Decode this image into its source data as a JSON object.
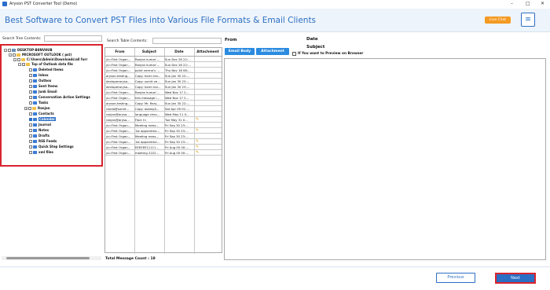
{
  "window": {
    "title": "Aryson PST Converter Tool (Demo)",
    "minimize": "–",
    "maximize": "□",
    "close": "✕"
  },
  "header": {
    "headline": "Best Software to Convert PST Files into Various File Formats & Email Clients",
    "live_chat": "Live Chat",
    "menu_icon": "≡"
  },
  "tree": {
    "search_label": "Search Tree Contents:",
    "search_value": "",
    "items": [
      {
        "label": "DESKTOP-B8NVHUB",
        "icon": "computer-icon"
      },
      {
        "label": "MICROSOFT OUTLOOK ( pst)",
        "icon": "folder-icon"
      },
      {
        "label": "C:\\Users\\Admin\\Downloads\\all forr",
        "icon": "folder-icon"
      },
      {
        "label": "Top of Outlook data file",
        "icon": "folder-icon"
      },
      {
        "label": "Deleted Items",
        "icon": "folder-icon"
      },
      {
        "label": "Inbox",
        "icon": "folder-icon"
      },
      {
        "label": "Outbox",
        "icon": "folder-icon"
      },
      {
        "label": "Sent Items",
        "icon": "folder-icon"
      },
      {
        "label": "Junk Email",
        "icon": "folder-icon"
      },
      {
        "label": "Conversation Action Settings",
        "icon": "folder-icon"
      },
      {
        "label": "Tasks",
        "icon": "folder-icon"
      },
      {
        "label": "Ranjan",
        "icon": "folder-icon"
      },
      {
        "label": "Contacts",
        "icon": "folder-icon"
      },
      {
        "label": "Calendar",
        "icon": "folder-icon"
      },
      {
        "label": "Journal",
        "icon": "folder-icon"
      },
      {
        "label": "Notes",
        "icon": "folder-icon"
      },
      {
        "label": "Drafts",
        "icon": "folder-icon"
      },
      {
        "label": "RSS Feeds",
        "icon": "folder-icon"
      },
      {
        "label": "Quick Step Settings",
        "icon": "folder-icon"
      },
      {
        "label": "xml files",
        "icon": "folder-icon"
      }
    ]
  },
  "table": {
    "search_label": "Search Table Contents:",
    "search_value": "",
    "headers": [
      "From",
      "Subject",
      "Date",
      "Attachment"
    ],
    "rows": [
      {
        "from": "/o=First Organ...",
        "subject": "Ranjan kumar’...",
        "date": "Sun Dec 26 22:...",
        "attachment": false
      },
      {
        "from": "/o=First Organ...",
        "subject": "Ranjan kumar’...",
        "date": "Sun Dec 26 22:...",
        "attachment": false
      },
      {
        "from": "/o=First Organ...",
        "subject": "point verma’s ...",
        "date": "Thu Nov 18 08:...",
        "attachment": false
      },
      {
        "from": "aryson.testing...",
        "subject": "Copy: harm hai...",
        "date": "Sun Jan 30 22:...",
        "attachment": false
      },
      {
        "from": "devloperaryso...",
        "subject": "Copy: sumit ve...",
        "date": "Sun Jan 30 22:...",
        "attachment": false
      },
      {
        "from": "devloperaryso...",
        "subject": "Copy: harm hai...",
        "date": "Sun Jan 30 23:...",
        "attachment": false
      },
      {
        "from": "/o=First Organ...",
        "subject": "Ranjan kumar’...",
        "date": "Wed Nov 17 2...",
        "attachment": false
      },
      {
        "from": "/o=First Organ...",
        "subject": "this message i...",
        "date": "Wed Nov 17 2...",
        "attachment": false
      },
      {
        "from": "aryson.testing...",
        "subject": "Copy: Mr. Ranj...",
        "date": "Sun Jan 30 22:...",
        "attachment": false
      },
      {
        "from": "randa@sumit...",
        "subject": "Copy: asdas(A...",
        "date": "Sat Apr 09 01:...",
        "attachment": false
      },
      {
        "from": "ranjan@aryso...",
        "subject": "language chec...",
        "date": "Wed May 11 0...",
        "attachment": false
      },
      {
        "from": "ranjan@aryso...",
        "subject": "Fwd: hi",
        "date": "Tue May 31 0...",
        "attachment": true
      },
      {
        "from": "/o=First Organ...",
        "subject": "Meeting mess...",
        "date": "Fri Sep 30 23:...",
        "attachment": false
      },
      {
        "from": "/o=First Organ...",
        "subject": "1st appointme...",
        "date": "Fri Sep 30 23:...",
        "attachment": true
      },
      {
        "from": "/o=First Organ...",
        "subject": "Meeting mess...",
        "date": "Fri Sep 30 23:...",
        "attachment": false
      },
      {
        "from": "/o=First Organ...",
        "subject": "1st appointme...",
        "date": "Fri Sep 30 23:...",
        "attachment": true
      },
      {
        "from": "/o=First Organ...",
        "subject": "EEEEEE11111...",
        "date": "Fri Aug 05 00:...",
        "attachment": true
      },
      {
        "from": "/o=First Organ...",
        "subject": "meeting 2222...",
        "date": "Fri Aug 05 00:...",
        "attachment": true
      }
    ],
    "total_label": "Total Message Count : 18"
  },
  "preview": {
    "from_label": "From",
    "date_label": "Date",
    "subject_label": "Subject",
    "email_body_button": "Email Body",
    "attachment_button": "Attachment",
    "preview_checkbox_label": "If You want to Preview on Browser"
  },
  "footer": {
    "previous_label": "Previous",
    "next_label": "Next"
  },
  "colors": {
    "accent": "#2b6fc4",
    "highlight": "#d9232e",
    "live_chat": "#f59a23"
  }
}
